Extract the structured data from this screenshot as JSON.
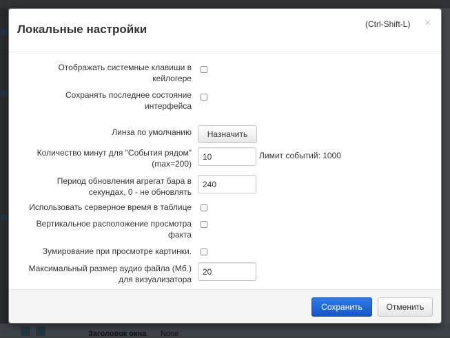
{
  "background": {
    "bottom_label": "Заголовок окна",
    "bottom_value": "None"
  },
  "dialog": {
    "title": "Локальные настройки",
    "shortcut": "(Ctrl-Shift-L)",
    "close_glyph": "×"
  },
  "settings": {
    "show_system_keys": {
      "label": "Отображать системные клавиши в кейлогере",
      "checked": false
    },
    "save_ui_state": {
      "label": "Сохранять последнее состояние интерфейса",
      "checked": false
    },
    "default_lens": {
      "label": "Линза по умолчанию",
      "button_label": "Назначить"
    },
    "events_minutes": {
      "label": "Количество минут для \"События рядом\" (max=200)",
      "value": "10",
      "note": "Лимит событий: 1000"
    },
    "refresh_period": {
      "label": "Период обновления агрегат бара в секундах, 0 - не обновлять",
      "value": "240"
    },
    "server_time": {
      "label": "Использовать серверное время в таблице",
      "checked": false
    },
    "vertical_layout": {
      "label": "Вертикальное расположение просмотра факта",
      "checked": false
    },
    "zoom_image": {
      "label": "Зумирование при просмотре картинки.",
      "checked": false
    },
    "max_audio_size": {
      "label": "Максимальный размер аудио файла (Мб.) для визуализатора",
      "value": "20"
    }
  },
  "footer": {
    "save_label": "Сохранить",
    "cancel_label": "Отменить"
  },
  "colors": {
    "primary_button": "#1a5fd0",
    "overlay": "#000000"
  }
}
